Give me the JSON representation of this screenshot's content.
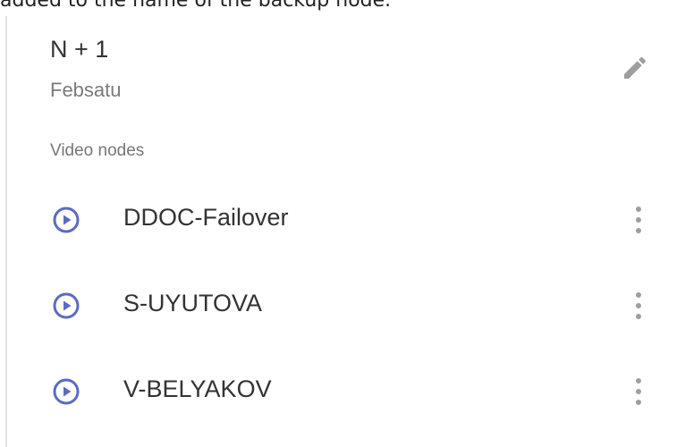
{
  "caption": "added to the name of the backup node.",
  "card": {
    "title": "N + 1",
    "subtitle": "Febsatu",
    "edit_icon": "pencil-icon"
  },
  "video_nodes": {
    "label": "Video nodes",
    "item_icon": "play-circle-icon",
    "menu_icon": "more-vertical-icon",
    "items": [
      {
        "name": "DDOC-Failover"
      },
      {
        "name": "S-UYUTOVA"
      },
      {
        "name": "V-BELYAKOV"
      }
    ]
  },
  "colors": {
    "accent": "#5c6bc0",
    "icon_gray": "#9e9e9e",
    "text": "#333333",
    "secondary_text": "#7a7a7a"
  }
}
